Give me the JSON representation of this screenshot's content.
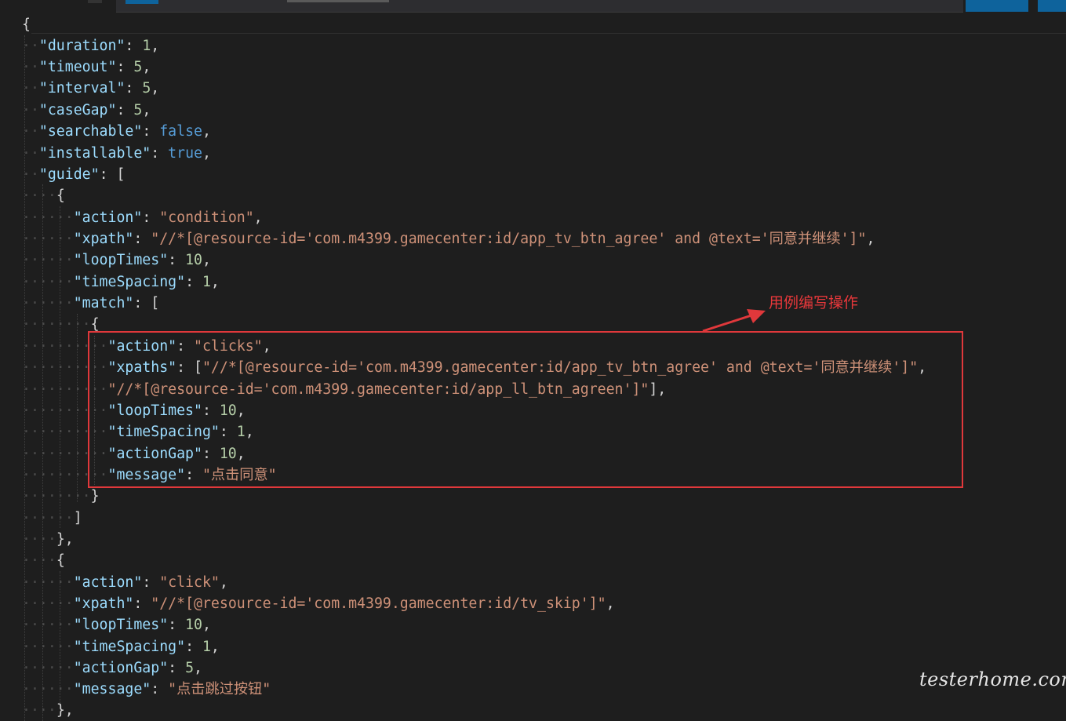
{
  "code": {
    "l1": "{",
    "duration_key": "\"duration\"",
    "duration_val": "1",
    "timeout_key": "\"timeout\"",
    "timeout_val": "5",
    "interval_key": "\"interval\"",
    "interval_val": "5",
    "caseGap_key": "\"caseGap\"",
    "caseGap_val": "5",
    "searchable_key": "\"searchable\"",
    "searchable_val": "false",
    "installable_key": "\"installable\"",
    "installable_val": "true",
    "guide_key": "\"guide\"",
    "g0_action_key": "\"action\"",
    "g0_action_val": "\"condition\"",
    "g0_xpath_key": "\"xpath\"",
    "g0_xpath_val": "\"//*[@resource-id='com.m4399.gamecenter:id/app_tv_btn_agree' and @text='同意并继续']\"",
    "g0_loopTimes_key": "\"loopTimes\"",
    "g0_loopTimes_val": "10",
    "g0_timeSpacing_key": "\"timeSpacing\"",
    "g0_timeSpacing_val": "1",
    "g0_match_key": "\"match\"",
    "m_action_key": "\"action\"",
    "m_action_val": "\"clicks\"",
    "m_xpaths_key": "\"xpaths\"",
    "m_xpaths_val1": "\"//*[@resource-id='com.m4399.gamecenter:id/app_tv_btn_agree' and @text='同意并继续']\"",
    "m_xpaths_val2": "\"//*[@resource-id='com.m4399.gamecenter:id/app_ll_btn_agreen']\"",
    "m_loopTimes_key": "\"loopTimes\"",
    "m_loopTimes_val": "10",
    "m_timeSpacing_key": "\"timeSpacing\"",
    "m_timeSpacing_val": "1",
    "m_actionGap_key": "\"actionGap\"",
    "m_actionGap_val": "10",
    "m_message_key": "\"message\"",
    "m_message_val": "\"点击同意\"",
    "g1_action_key": "\"action\"",
    "g1_action_val": "\"click\"",
    "g1_xpath_key": "\"xpath\"",
    "g1_xpath_val": "\"//*[@resource-id='com.m4399.gamecenter:id/tv_skip']\"",
    "g1_loopTimes_key": "\"loopTimes\"",
    "g1_loopTimes_val": "10",
    "g1_timeSpacing_key": "\"timeSpacing\"",
    "g1_timeSpacing_val": "1",
    "g1_actionGap_key": "\"actionGap\"",
    "g1_actionGap_val": "5",
    "g1_message_key": "\"message\"",
    "g1_message_val": "\"点击跳过按钮\""
  },
  "annotation": {
    "label": "用例编写操作",
    "color": "#e8383b"
  },
  "watermark": "testerhome.com",
  "colors": {
    "background": "#1e1e1e",
    "key": "#9cdcfe",
    "string": "#ce9178",
    "number": "#b5cea8",
    "keyword": "#569cd6"
  }
}
